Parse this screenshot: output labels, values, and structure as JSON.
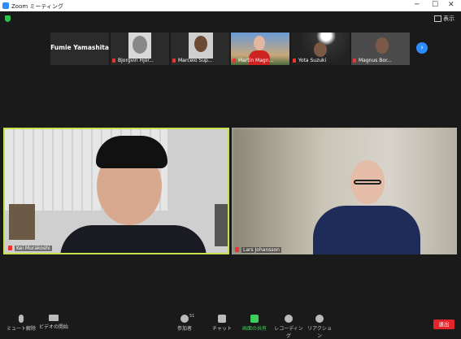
{
  "window": {
    "title": "Zoom ミーティング"
  },
  "view": {
    "label": "表示"
  },
  "strip": {
    "names": [
      "Fumie Yamashita",
      "Bjorgvin Hjör...",
      "Marcelo Sup...",
      "Martin Magn...",
      "Yota Suzuki",
      "Magnus Bor..."
    ]
  },
  "tiles": {
    "left_name": "Kei Murakoshi",
    "right_name": "Lars Johansson"
  },
  "toolbar": {
    "unmute": "ミュート解除",
    "video": "ビデオの開始",
    "participants": "参加者",
    "participants_count": "51",
    "chat": "チャット",
    "share": "画面の共有",
    "record": "レコーディング",
    "reactions": "リアクション",
    "leave": "退出"
  },
  "colors": {
    "accent": "#2d8cff",
    "share_green": "#3ed05a",
    "leave_red": "#e0262b",
    "active_border": "#c8e04b"
  }
}
